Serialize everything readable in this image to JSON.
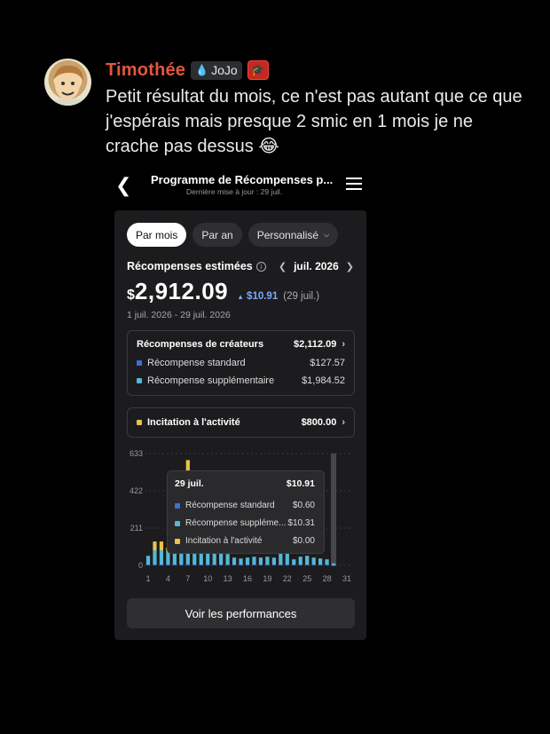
{
  "message": {
    "username": "Timothée",
    "tag_label": "JoJo",
    "text": "Petit résultat du mois, ce n'est pas autant que ce que j'espérais mais presque 2 smic en 1 mois je ne crache pas dessus 😂"
  },
  "phone": {
    "nav": {
      "title": "Programme de Récompenses p...",
      "subtitle": "Dernière mise à jour : 29 juil."
    },
    "tabs": [
      {
        "label": "Par mois",
        "active": true
      },
      {
        "label": "Par an",
        "active": false
      },
      {
        "label": "Personnalisé",
        "active": false
      }
    ],
    "estimated": {
      "label": "Récompenses estimées",
      "month": "juil. 2026",
      "currency": "$",
      "total": "2,912.09",
      "delta": "$10.91",
      "delta_date": "(29 juil.)",
      "range": "1 juil. 2026 - 29 juil. 2026"
    },
    "creator_rewards": {
      "label": "Récompenses de créateurs",
      "value": "$2,112.09",
      "items": [
        {
          "label": "Récompense standard",
          "value": "$127.57",
          "color": "#3d6fd8"
        },
        {
          "label": "Récompense supplémentaire",
          "value": "$1,984.52",
          "color": "#56b7d6"
        }
      ]
    },
    "activity": {
      "label": "Incitation à l'activité",
      "value": "$800.00",
      "color": "#e8c44a"
    },
    "tooltip": {
      "date": "29 juil.",
      "total": "$10.91",
      "rows": [
        {
          "label": "Récompense standard",
          "value": "$0.60",
          "color": "#3d6fd8"
        },
        {
          "label": "Récompense suppléme...",
          "value": "$10.31",
          "color": "#56b7d6"
        },
        {
          "label": "Incitation à l'activité",
          "value": "$0.00",
          "color": "#e8c44a"
        }
      ]
    },
    "performance_button": "Voir les performances"
  },
  "chart_data": {
    "type": "bar",
    "stacked": true,
    "yticks": [
      "633",
      "422",
      "211",
      "0"
    ],
    "xticks": [
      "1",
      "4",
      "7",
      "10",
      "13",
      "16",
      "19",
      "22",
      "25",
      "28",
      "31"
    ],
    "ylim": [
      0,
      633
    ],
    "x": [
      1,
      2,
      3,
      4,
      5,
      6,
      7,
      8,
      9,
      10,
      11,
      12,
      13,
      14,
      15,
      16,
      17,
      18,
      19,
      20,
      21,
      22,
      23,
      24,
      25,
      26,
      27,
      28,
      29
    ],
    "series": [
      {
        "name": "Récompense standard",
        "color": "#3d6fd8",
        "values": [
          4,
          5,
          5,
          5,
          5,
          5,
          6,
          5,
          5,
          5,
          5,
          5,
          4,
          4,
          4,
          4,
          4,
          4,
          4,
          4,
          4,
          4,
          4,
          4,
          4,
          4,
          4,
          4,
          0.6
        ]
      },
      {
        "name": "Récompense supplémentaire",
        "color": "#56b7d6",
        "values": [
          50,
          80,
          80,
          70,
          60,
          70,
          90,
          80,
          75,
          70,
          80,
          75,
          60,
          40,
          35,
          40,
          45,
          40,
          45,
          40,
          70,
          65,
          30,
          45,
          50,
          40,
          35,
          30,
          10.31
        ]
      },
      {
        "name": "Incitation à l'activité",
        "color": "#e8c44a",
        "values": [
          0,
          50,
          50,
          25,
          20,
          30,
          500,
          30,
          0,
          0,
          0,
          0,
          0,
          0,
          0,
          0,
          0,
          0,
          0,
          0,
          0,
          0,
          0,
          0,
          0,
          0,
          0,
          0,
          0
        ]
      }
    ],
    "highlight_x": 29
  }
}
